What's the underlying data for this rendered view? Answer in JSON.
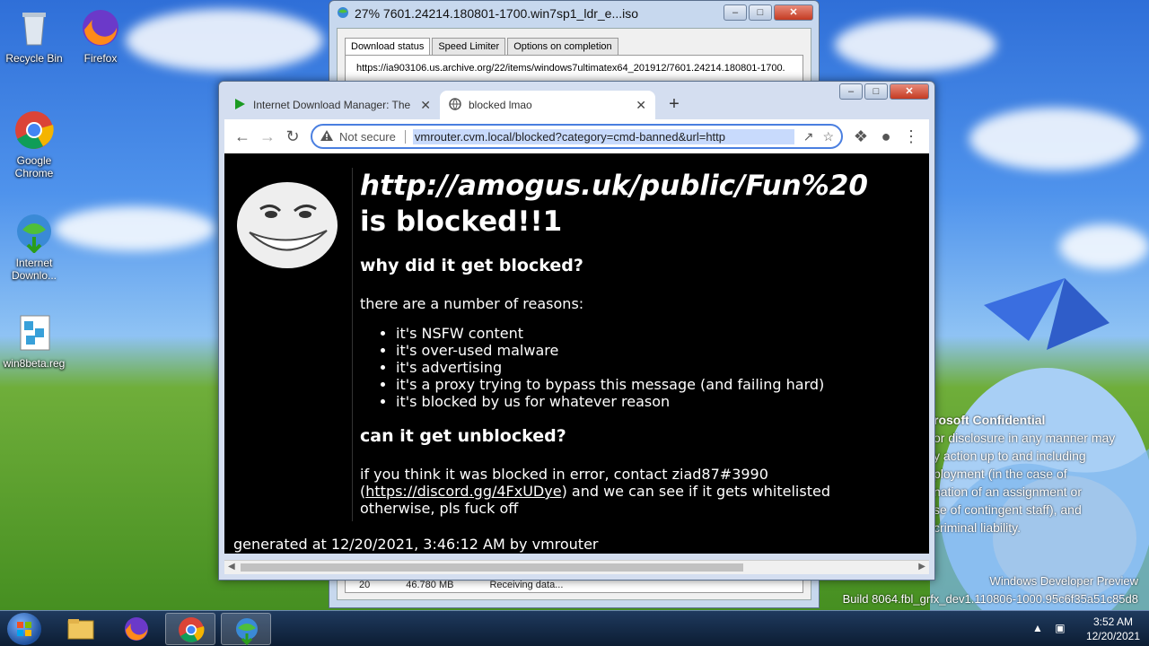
{
  "desktop": {
    "icons": [
      {
        "label": "Recycle Bin"
      },
      {
        "label": "Firefox"
      },
      {
        "label": "Google Chrome"
      },
      {
        "label": "Internet Downlo..."
      },
      {
        "label": "win8beta.reg"
      }
    ]
  },
  "idm": {
    "title": "27% 7601.24214.180801-1700.win7sp1_ldr_e...iso",
    "tabs": [
      "Download status",
      "Speed Limiter",
      "Options on completion"
    ],
    "url": "https://ia903106.us.archive.org/22/items/windows7ultimatex64_201912/7601.24214.180801-1700.",
    "row": {
      "count": "20",
      "size": "46.780 MB",
      "status": "Receiving data..."
    }
  },
  "chrome": {
    "tabs": [
      {
        "label": "Internet Download Manager: The"
      },
      {
        "label": "blocked lmao"
      }
    ],
    "address": {
      "security": "Not secure",
      "url": "vmrouter.cvm.local/blocked?category=cmd-banned&url=http"
    },
    "page": {
      "blocked_url": "http://amogus.uk/public/Fun%20",
      "blocked_suffix": "is blocked!!1",
      "why_heading": "why did it get blocked?",
      "reasons_intro": "there are a number of reasons:",
      "reasons": [
        "it's NSFW content",
        "it's over-used malware",
        "it's advertising",
        "it's a proxy trying to bypass this message (and failing hard)",
        "it's blocked by us for whatever reason"
      ],
      "unblock_heading": "can it get unblocked?",
      "contact_text": "if you think it was blocked in error, contact ziad87#3990",
      "discord_open": "(",
      "discord_link": "https://discord.gg/4FxUDye",
      "discord_close": ") and we can see if it gets whitelisted",
      "otherwise": "otherwise, pls fuck off",
      "footer": "generated at 12/20/2021, 3:46:12 AM by vmrouter"
    }
  },
  "watermark": {
    "title": "rosoft Confidential",
    "lines": [
      "or disclosure in any manner may",
      "y action up to and including",
      "ployment (in the case of",
      "nation of an assignment or",
      "se of contingent staff), and",
      "criminal liability."
    ]
  },
  "build": {
    "line1": "Windows Developer Preview",
    "line2": "Build 8064.fbl_grfx_dev1.110806-1000.95c6f35a51c85d8"
  },
  "taskbar": {
    "time": "3:52 AM",
    "date": "12/20/2021"
  }
}
